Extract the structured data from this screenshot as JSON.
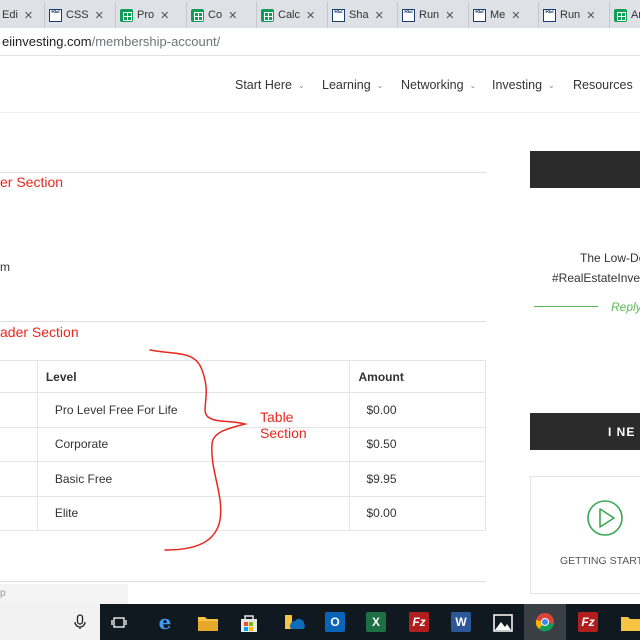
{
  "browser": {
    "tabs": [
      {
        "label": "Edi",
        "icon": "document-icon"
      },
      {
        "label": "CSS",
        "icon": "rei-icon"
      },
      {
        "label": "Pro",
        "icon": "sheets-icon"
      },
      {
        "label": "Co",
        "icon": "sheets-icon"
      },
      {
        "label": "Calc",
        "icon": "sheets-icon"
      },
      {
        "label": "Sha",
        "icon": "rei-icon"
      },
      {
        "label": "Run",
        "icon": "rei-icon"
      },
      {
        "label": "Me",
        "icon": "rei-icon"
      },
      {
        "label": "Run",
        "icon": "rei-icon"
      },
      {
        "label": "Ar",
        "icon": "sheets-icon"
      }
    ],
    "close_glyph": "✕",
    "address_host": "eiinvesting.com",
    "address_path": "/membership-account/"
  },
  "nav": {
    "items": [
      "Start Here",
      "Learning",
      "Networking",
      "Investing",
      "Resources"
    ]
  },
  "main": {
    "annotations": {
      "header": "er Section",
      "subheader": "ader Section",
      "table": "Table\nSection"
    },
    "body_fragment": "m",
    "table": {
      "headers": [
        "",
        "Level",
        "Amount"
      ],
      "rows": [
        {
          "level": "Pro Level Free For Life",
          "amount": "$0.00"
        },
        {
          "level": "Corporate",
          "amount": "$0.50"
        },
        {
          "level": "Basic Free",
          "amount": "$9.95"
        },
        {
          "level": "Elite",
          "amount": "$0.00"
        }
      ]
    },
    "search_placeholder": "p"
  },
  "sidebar": {
    "text_line1": "The Low-Do",
    "text_line2": "#RealEstateInve",
    "reply": "Reply",
    "heading": "I NE",
    "card_label": "GETTING STARTI"
  },
  "colors": {
    "annotation": "#e8281e",
    "reply_green": "#5cb85c",
    "sidebar_dark": "#2b2b2b",
    "taskbar": "#101820"
  },
  "taskbar": {
    "icons": [
      "microphone-icon",
      "task-view-icon",
      "edge-icon",
      "file-explorer-icon",
      "store-icon",
      "onedrive-icon",
      "outlook-icon",
      "excel-icon",
      "filezilla-icon",
      "word-icon",
      "photos-icon",
      "chrome-icon",
      "filezilla-icon"
    ]
  }
}
